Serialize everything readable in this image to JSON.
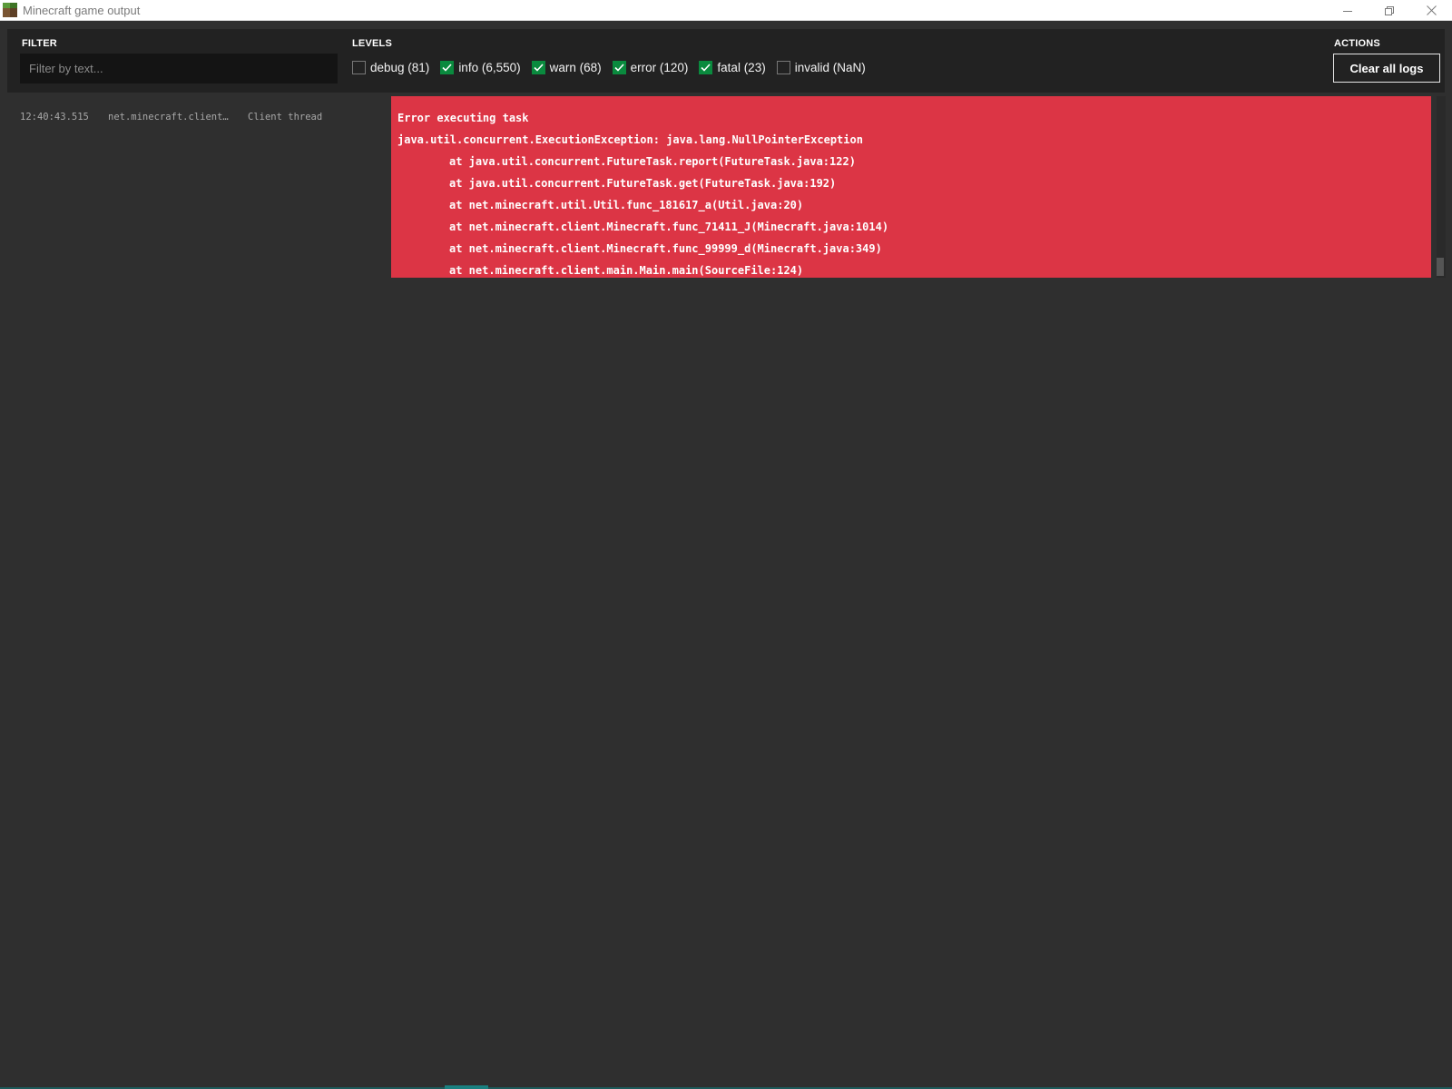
{
  "window": {
    "title": "Minecraft game output",
    "icon": "minecraft-grass-block-icon"
  },
  "toolbar": {
    "filter_label": "FILTER",
    "filter_placeholder": "Filter by text...",
    "filter_value": "",
    "levels_label": "LEVELS",
    "levels": [
      {
        "label": "debug (81)",
        "checked": false
      },
      {
        "label": "info (6,550)",
        "checked": true
      },
      {
        "label": "warn (68)",
        "checked": true
      },
      {
        "label": "error (120)",
        "checked": true
      },
      {
        "label": "fatal (23)",
        "checked": true
      },
      {
        "label": "invalid (NaN)",
        "checked": false
      }
    ],
    "actions_label": "ACTIONS",
    "clear_label": "Clear all logs"
  },
  "log": {
    "entries": [
      {
        "time": "12:40:43.515",
        "source": "net.minecraft.client…",
        "thread": "Client thread",
        "level_color": "#dc3545",
        "lines": [
          "Error executing task",
          "java.util.concurrent.ExecutionException: java.lang.NullPointerException",
          "at java.util.concurrent.FutureTask.report(FutureTask.java:122)",
          "at java.util.concurrent.FutureTask.get(FutureTask.java:192)",
          "at net.minecraft.util.Util.func_181617_a(Util.java:20)",
          "at net.minecraft.client.Minecraft.func_71411_J(Minecraft.java:1014)",
          "at net.minecraft.client.Minecraft.func_99999_d(Minecraft.java:349)",
          "at net.minecraft.client.main.Main.main(SourceFile:124)"
        ]
      }
    ]
  },
  "colors": {
    "background": "#2f2f2f",
    "toolbar": "#222222",
    "checkbox_checked": "#0a8a3e",
    "error": "#dc3545"
  }
}
